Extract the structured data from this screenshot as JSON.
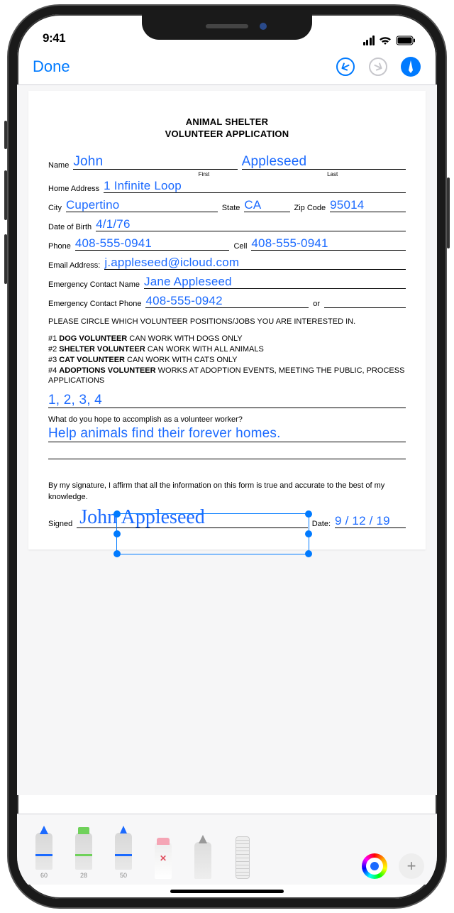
{
  "status": {
    "time": "9:41"
  },
  "nav": {
    "done": "Done"
  },
  "document": {
    "title1": "ANIMAL SHELTER",
    "title2": "VOLUNTEER APPLICATION",
    "labels": {
      "name": "Name",
      "first": "First",
      "last": "Last",
      "home_address": "Home Address",
      "city": "City",
      "state": "State",
      "zip": "Zip Code",
      "dob": "Date of Birth",
      "phone": "Phone",
      "cell": "Cell",
      "email": "Email Address:",
      "emergency_name": "Emergency Contact Name",
      "emergency_phone": "Emergency Contact Phone",
      "or": "or",
      "signed": "Signed",
      "date": "Date:"
    },
    "values": {
      "first_name": "John",
      "last_name": "Appleseed",
      "home_address": "1 Infinite Loop",
      "city": "Cupertino",
      "state": "CA",
      "zip": "95014",
      "dob": "4/1/76",
      "phone": "408-555-0941",
      "cell": "408-555-0941",
      "email": "j.appleseed@icloud.com",
      "emergency_name": "Jane Appleseed",
      "emergency_phone": "408-555-0942",
      "positions_answer": "1, 2, 3, 4",
      "goal": "Help animals find their forever homes.",
      "signature": "John Appleseed",
      "sign_date": "9 / 12 / 19"
    },
    "section1": "PLEASE CIRCLE WHICH VOLUNTEER POSITIONS/JOBS YOU ARE INTERESTED IN.",
    "positions": {
      "p1_num": "#1 ",
      "p1_b": "DOG VOLUNTEER",
      "p1_t": " CAN WORK WITH DOGS ONLY",
      "p2_num": "#2 ",
      "p2_b": "SHELTER VOLUNTEER",
      "p2_t": " CAN WORK WITH ALL ANIMALS",
      "p3_num": "#3 ",
      "p3_b": "CAT VOLUNTEER",
      "p3_t": " CAN WORK WITH CATS ONLY",
      "p4_num": "#4 ",
      "p4_b": "ADOPTIONS VOLUNTEER",
      "p4_t": " WORKS AT ADOPTION EVENTS, MEETING THE PUBLIC, PROCESS APPLICATIONS"
    },
    "question": "What do you hope to accomplish as a volunteer worker?",
    "affirm": "By my signature, I affirm that all the information on this form is true and accurate to the best of my knowledge."
  },
  "toolbar": {
    "sizes": {
      "pen": "60",
      "highlighter": "28",
      "pencil": "50"
    }
  }
}
